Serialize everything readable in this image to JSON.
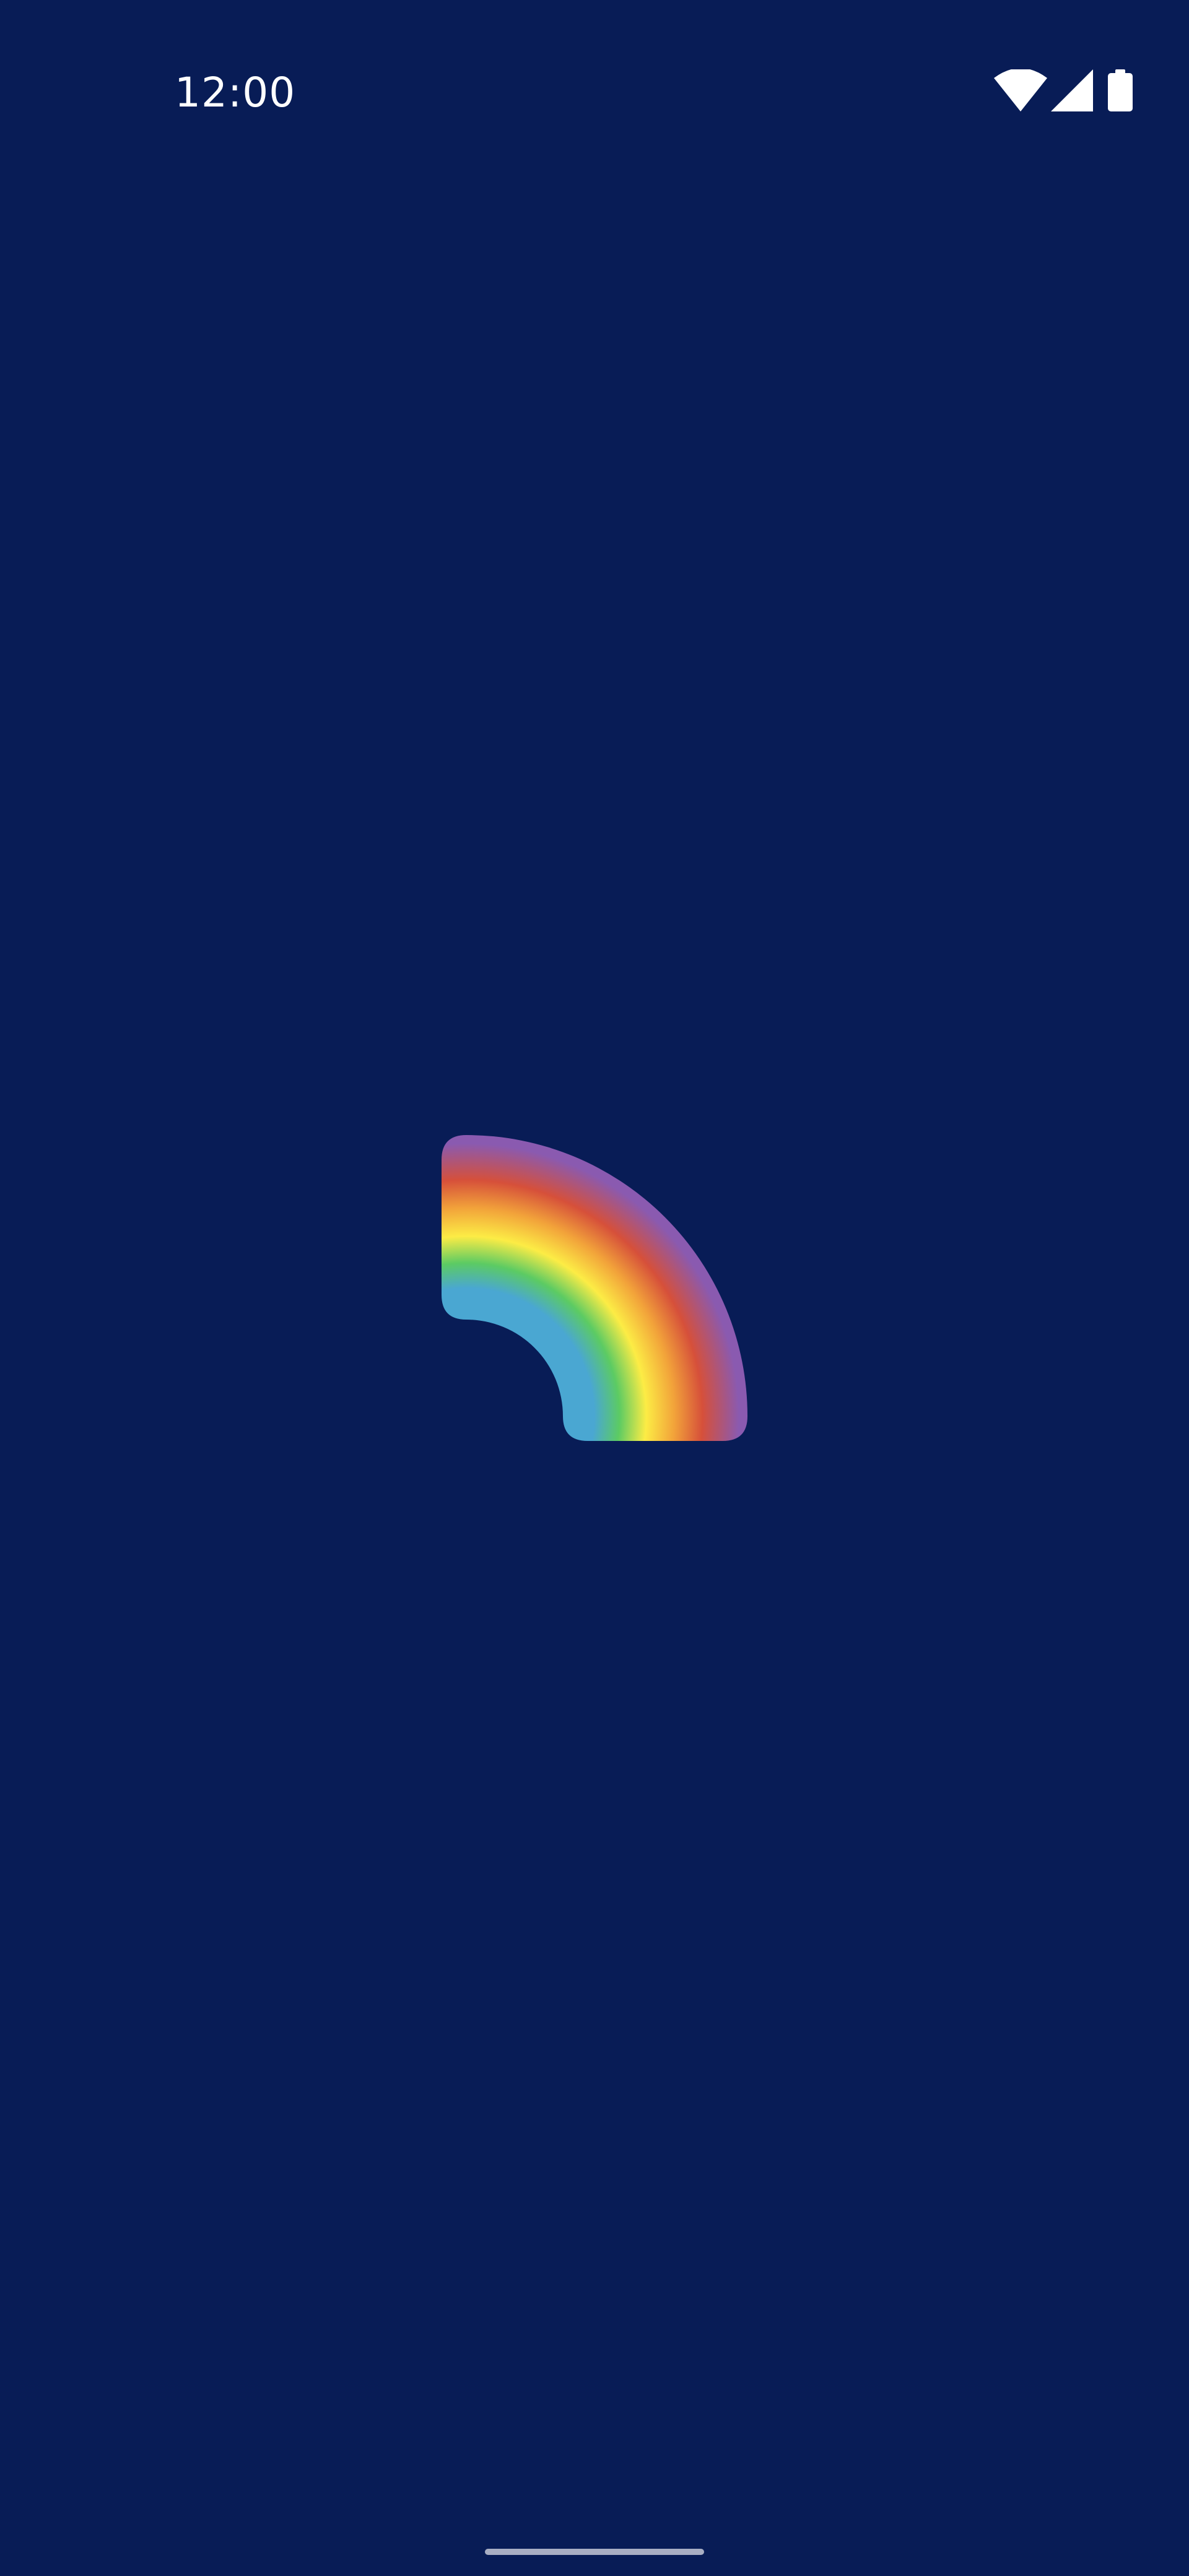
{
  "theme": {
    "background": "#081c56",
    "status_foreground": "#ffffff",
    "home_indicator": "#a8aec3"
  },
  "status_bar": {
    "time": "12:00",
    "icons": [
      "wifi-icon",
      "cell-signal-icon",
      "battery-icon"
    ]
  },
  "splash": {
    "logo": "rainbow-logo",
    "bands": [
      {
        "name": "violet",
        "color": "#8a5ab0"
      },
      {
        "name": "red",
        "color": "#d6503a"
      },
      {
        "name": "orange",
        "color": "#f2a33a"
      },
      {
        "name": "yellow",
        "color": "#fcec45"
      },
      {
        "name": "green",
        "color": "#5ccb63"
      },
      {
        "name": "blue",
        "color": "#4aa7d2"
      }
    ]
  },
  "navigation": {
    "gesture_handle": "home-indicator"
  }
}
